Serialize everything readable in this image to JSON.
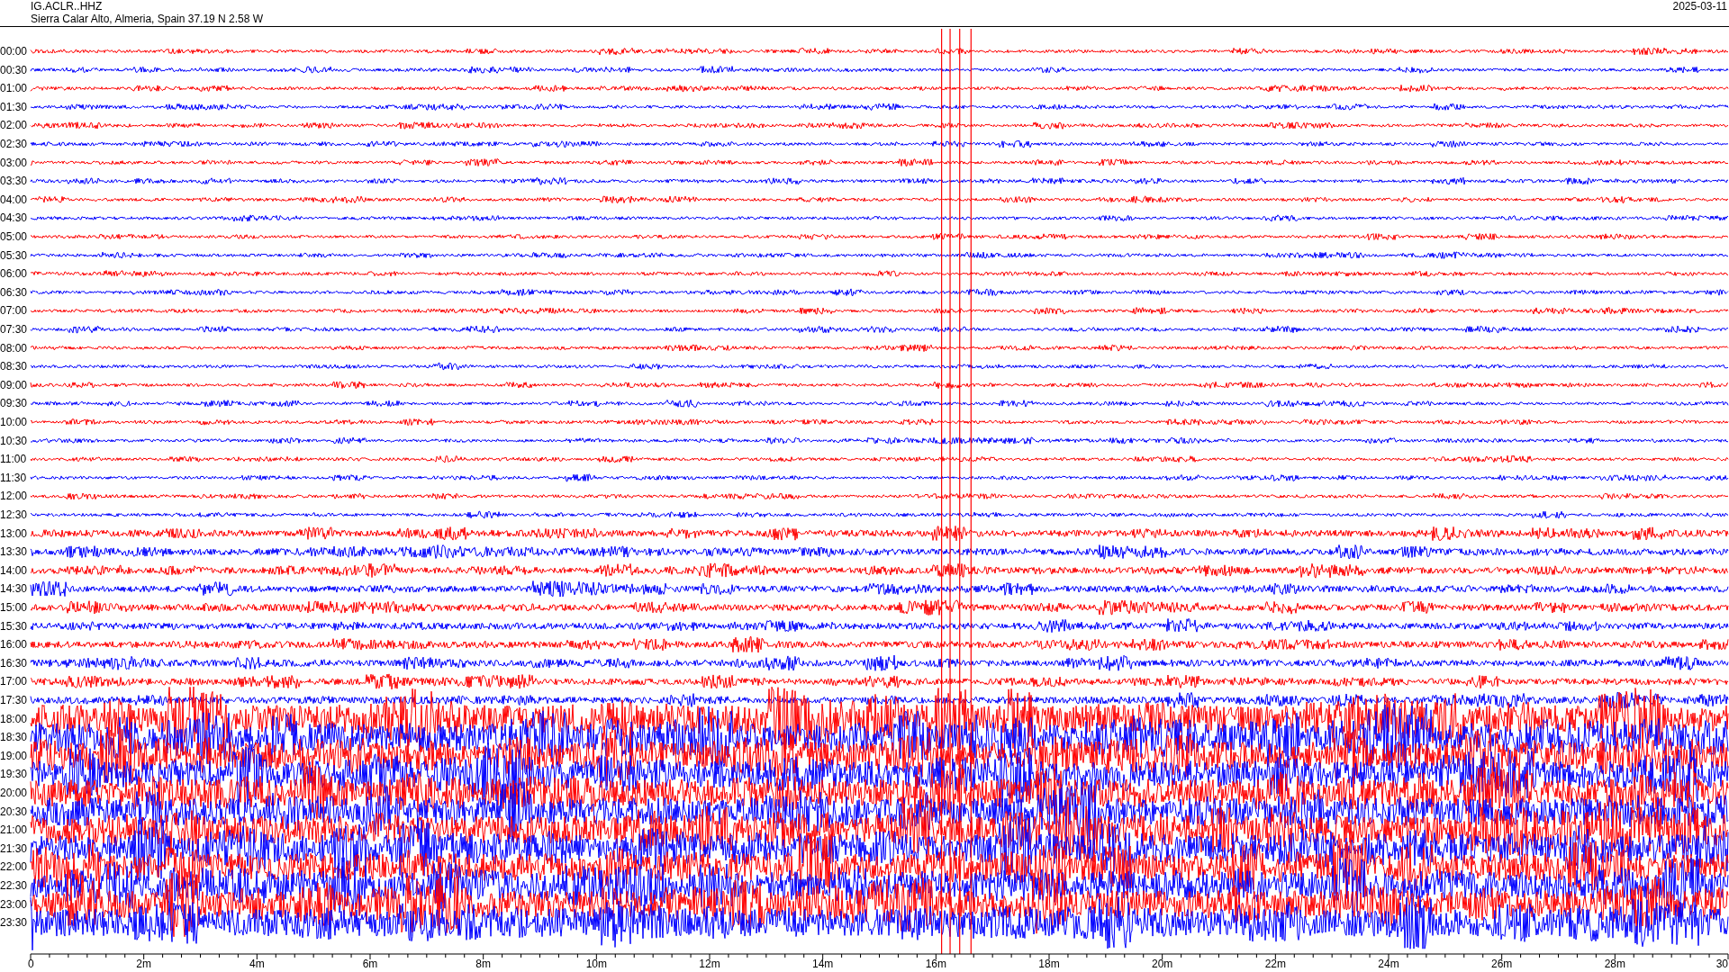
{
  "header": {
    "station": "IG.ACLR..HHZ",
    "location": "Sierra Calar Alto, Almeria, Spain  37.19 N 2.58 W",
    "date": "2025-03-11"
  },
  "rows": [
    {
      "time": "00:00",
      "color": "#ff0000"
    },
    {
      "time": "00:30",
      "color": "#0000ff"
    },
    {
      "time": "01:00",
      "color": "#ff0000"
    },
    {
      "time": "01:30",
      "color": "#0000ff"
    },
    {
      "time": "02:00",
      "color": "#ff0000"
    },
    {
      "time": "02:30",
      "color": "#0000ff"
    },
    {
      "time": "03:00",
      "color": "#ff0000"
    },
    {
      "time": "03:30",
      "color": "#0000ff"
    },
    {
      "time": "04:00",
      "color": "#ff0000"
    },
    {
      "time": "04:30",
      "color": "#0000ff"
    },
    {
      "time": "05:00",
      "color": "#ff0000"
    },
    {
      "time": "05:30",
      "color": "#0000ff"
    },
    {
      "time": "06:00",
      "color": "#ff0000"
    },
    {
      "time": "06:30",
      "color": "#0000ff"
    },
    {
      "time": "07:00",
      "color": "#ff0000"
    },
    {
      "time": "07:30",
      "color": "#0000ff"
    },
    {
      "time": "08:00",
      "color": "#ff0000"
    },
    {
      "time": "08:30",
      "color": "#0000ff"
    },
    {
      "time": "09:00",
      "color": "#ff0000"
    },
    {
      "time": "09:30",
      "color": "#0000ff"
    },
    {
      "time": "10:00",
      "color": "#ff0000"
    },
    {
      "time": "10:30",
      "color": "#0000ff"
    },
    {
      "time": "11:00",
      "color": "#ff0000"
    },
    {
      "time": "11:30",
      "color": "#0000ff"
    },
    {
      "time": "12:00",
      "color": "#ff0000"
    },
    {
      "time": "12:30",
      "color": "#0000ff"
    },
    {
      "time": "13:00",
      "color": "#ff0000"
    },
    {
      "time": "13:30",
      "color": "#0000ff"
    },
    {
      "time": "14:00",
      "color": "#ff0000"
    },
    {
      "time": "14:30",
      "color": "#0000ff"
    },
    {
      "time": "15:00",
      "color": "#ff0000"
    },
    {
      "time": "15:30",
      "color": "#0000ff"
    },
    {
      "time": "16:00",
      "color": "#ff0000"
    },
    {
      "time": "16:30",
      "color": "#0000ff"
    },
    {
      "time": "17:00",
      "color": "#ff0000"
    },
    {
      "time": "17:30",
      "color": "#0000ff"
    },
    {
      "time": "18:00",
      "color": "#ff0000"
    },
    {
      "time": "18:30",
      "color": "#0000ff"
    },
    {
      "time": "19:00",
      "color": "#ff0000"
    },
    {
      "time": "19:30",
      "color": "#0000ff"
    },
    {
      "time": "20:00",
      "color": "#ff0000"
    },
    {
      "time": "20:30",
      "color": "#0000ff"
    },
    {
      "time": "21:00",
      "color": "#ff0000"
    },
    {
      "time": "21:30",
      "color": "#0000ff"
    },
    {
      "time": "22:00",
      "color": "#ff0000"
    },
    {
      "time": "22:30",
      "color": "#0000ff"
    },
    {
      "time": "23:00",
      "color": "#ff0000"
    },
    {
      "time": "23:30",
      "color": "#0000ff"
    }
  ],
  "x_axis": {
    "ticks": [
      "0",
      "2m",
      "4m",
      "6m",
      "8m",
      "10m",
      "12m",
      "14m",
      "16m",
      "18m",
      "20m",
      "22m",
      "24m",
      "26m",
      "28m",
      "30"
    ]
  }
}
